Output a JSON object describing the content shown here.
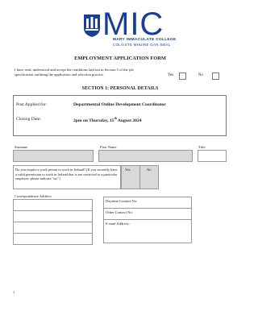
{
  "logo": {
    "wordmark": "MIC",
    "line1": "MARY IMMACULATE COLLEGE",
    "line2": "COLÁISTE MHUIRE GAN SMÁL",
    "color": "#1d3f8a"
  },
  "form_title": "EMPLOYMENT APPLICATION FORM",
  "declaration": {
    "text": "I have read, understood and accept the conditions laid out in Section 5 of the job specification outlining the application and selection process.",
    "yes_label": "Yes",
    "no_label": "No"
  },
  "section1_title": "SECTION 1:  PERSONAL DETAILS",
  "post": {
    "post_label": "Post Applied for:",
    "post_value": "Departmental Online Development Coordinator",
    "closing_label": "Closing Date:",
    "closing_value_pre": "2pm on Thursday, 15",
    "closing_value_sup": "th",
    "closing_value_post": " August 2024"
  },
  "name_fields": {
    "surname_label": "Surname",
    "first_name_label": "First Name",
    "title_label": "Title"
  },
  "work_permit": {
    "question": "Do you require a work permit to work in Ireland? (If you currently have a valid permission to work in Ireland that is not restricted to a particular employer, please indicate \"no\".)",
    "yes_label": "Yes",
    "no_label": "No"
  },
  "contact": {
    "correspondence_label": "Correspondence Address",
    "daytime_label": "Daytime Contact No:",
    "other_label": "Other Contact No:",
    "email_label": "E-mail Address:"
  },
  "page_number": "1"
}
